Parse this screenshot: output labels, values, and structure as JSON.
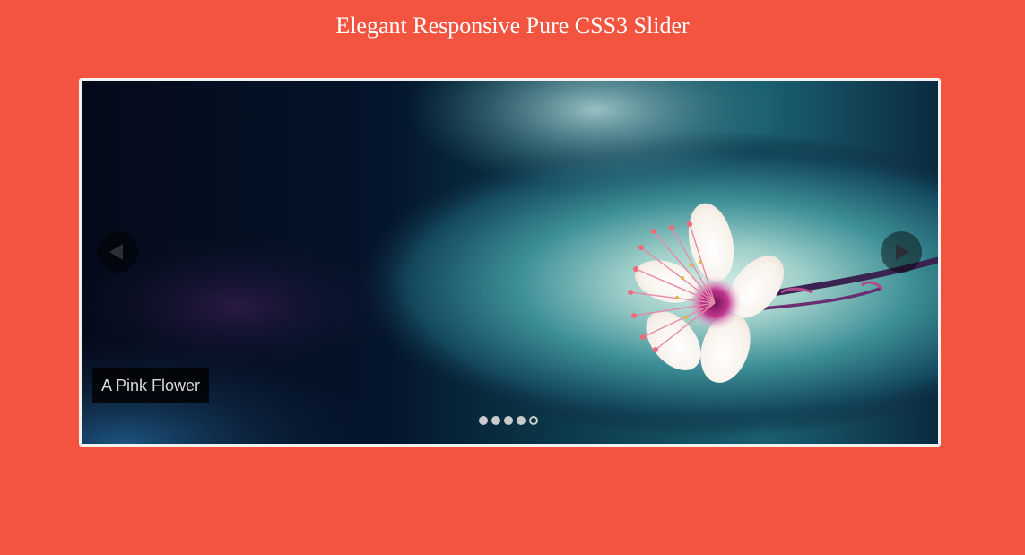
{
  "page": {
    "title": "Elegant Responsive Pure CSS3 Slider"
  },
  "slider": {
    "caption": "A Pink Flower",
    "prev_icon": "triangle-left-icon",
    "next_icon": "triangle-right-icon",
    "slide_count": 5,
    "active_slide": 5,
    "colors": {
      "background": "#f25440",
      "frame": "#f1f1f1",
      "dot": "#c9ccce"
    }
  }
}
